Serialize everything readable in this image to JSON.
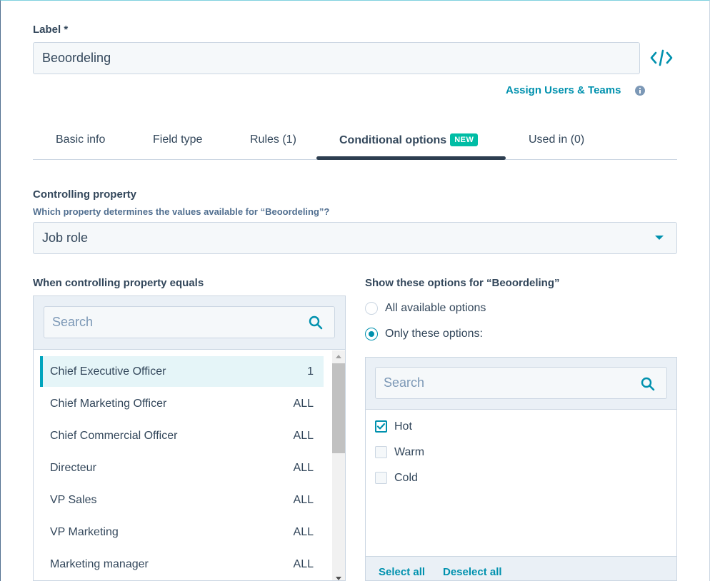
{
  "label": {
    "title": "Label *",
    "value": "Beoordeling"
  },
  "assign_link": "Assign Users & Teams",
  "tabs": [
    {
      "label": "Basic info"
    },
    {
      "label": "Field type"
    },
    {
      "label": "Rules (1)"
    },
    {
      "label": "Conditional options",
      "badge": "NEW"
    },
    {
      "label": "Used in (0)"
    }
  ],
  "controlling": {
    "title": "Controlling property",
    "help": "Which property determines the values available for “Beoordeling”?",
    "value": "Job role"
  },
  "left": {
    "title": "When controlling property equals",
    "search_placeholder": "Search",
    "items": [
      {
        "label": "Chief Executive Officer",
        "count": "1"
      },
      {
        "label": "Chief Marketing Officer",
        "count": "ALL"
      },
      {
        "label": "Chief Commercial Officer",
        "count": "ALL"
      },
      {
        "label": "Directeur",
        "count": "ALL"
      },
      {
        "label": "VP Sales",
        "count": "ALL"
      },
      {
        "label": "VP Marketing",
        "count": "ALL"
      },
      {
        "label": "Marketing manager",
        "count": "ALL"
      }
    ]
  },
  "right": {
    "title": "Show these options for “Beoordeling”",
    "radio_all": "All available options",
    "radio_only": "Only these options:",
    "search_placeholder": "Search",
    "options": [
      {
        "label": "Hot",
        "checked": true
      },
      {
        "label": "Warm",
        "checked": false
      },
      {
        "label": "Cold",
        "checked": false
      }
    ],
    "select_all": "Select all",
    "deselect_all": "Deselect all"
  },
  "icons": {
    "code": "code-icon",
    "info": "info-icon",
    "search": "search-icon",
    "caret": "chevron-down-icon"
  },
  "colors": {
    "accent": "#0091ae",
    "badge": "#00bda5",
    "text": "#33475b",
    "panel": "#eaf0f6"
  }
}
